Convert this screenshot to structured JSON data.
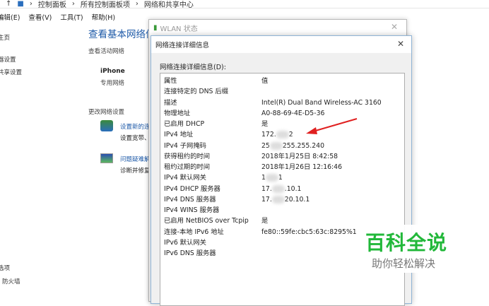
{
  "breadcrumb": {
    "items": [
      "控制面板",
      "所有控制面板项",
      "网络和共享中心"
    ]
  },
  "menu": [
    "编辑(E)",
    "查看(V)",
    "工具(T)",
    "帮助(H)"
  ],
  "sidebar": {
    "items": [
      "主页",
      "器设置",
      "共享设置",
      "选项",
      "防火墙"
    ]
  },
  "main": {
    "title": "查看基本网络信",
    "active_label": "查看活动网络",
    "network_name": "iPhone",
    "network_type": "专用网络",
    "change_label": "更改网络设置",
    "setup_link": "设置新的连",
    "setup_desc": "设置宽带、",
    "trouble_link": "问题疑难解",
    "trouble_desc": "诊断并修复"
  },
  "wlan": {
    "title": "WLAN 状态"
  },
  "details": {
    "title": "网络连接详细信息",
    "list_label": "网络连接详细信息(D):",
    "rows": [
      {
        "p": "属性",
        "v": "值"
      },
      {
        "p": "连接特定的 DNS 后缀",
        "v": ""
      },
      {
        "p": "描述",
        "v": "Intel(R) Dual Band Wireless-AC 3160"
      },
      {
        "p": "物理地址",
        "v": "A0-88-69-4E-D5-36"
      },
      {
        "p": "已启用 DHCP",
        "v": "是"
      },
      {
        "p": "IPv4 地址",
        "v": "172.",
        "v2": "2"
      },
      {
        "p": "IPv4 子网掩码",
        "v": "25",
        "v2": "255.255.240"
      },
      {
        "p": "获得租约的时间",
        "v": "2018年1月25日 8:42:58"
      },
      {
        "p": "租约过期的时间",
        "v": "2018年1月26日 12:16:46"
      },
      {
        "p": "IPv4 默认网关",
        "v": "1",
        "v2": "1"
      },
      {
        "p": "IPv4 DHCP 服务器",
        "v": "17.",
        "v2": ".10.1"
      },
      {
        "p": "IPv4 DNS 服务器",
        "v": "17.",
        "v2": "20.10.1"
      },
      {
        "p": "IPv4 WINS 服务器",
        "v": ""
      },
      {
        "p": "已启用 NetBIOS over Tcpip",
        "v": "是"
      },
      {
        "p": "连接-本地 IPv6 地址",
        "v": "fe80::59fe:cbc5:63c:8295%1"
      },
      {
        "p": "IPv6 默认网关",
        "v": ""
      },
      {
        "p": "IPv6 DNS 服务器",
        "v": ""
      }
    ]
  },
  "watermark": {
    "title": "百科全说",
    "subtitle": "助你轻松解决"
  },
  "colors": {
    "accent": "#1e5aa8",
    "watermark": "#22b83a",
    "arrow": "#e02020"
  }
}
